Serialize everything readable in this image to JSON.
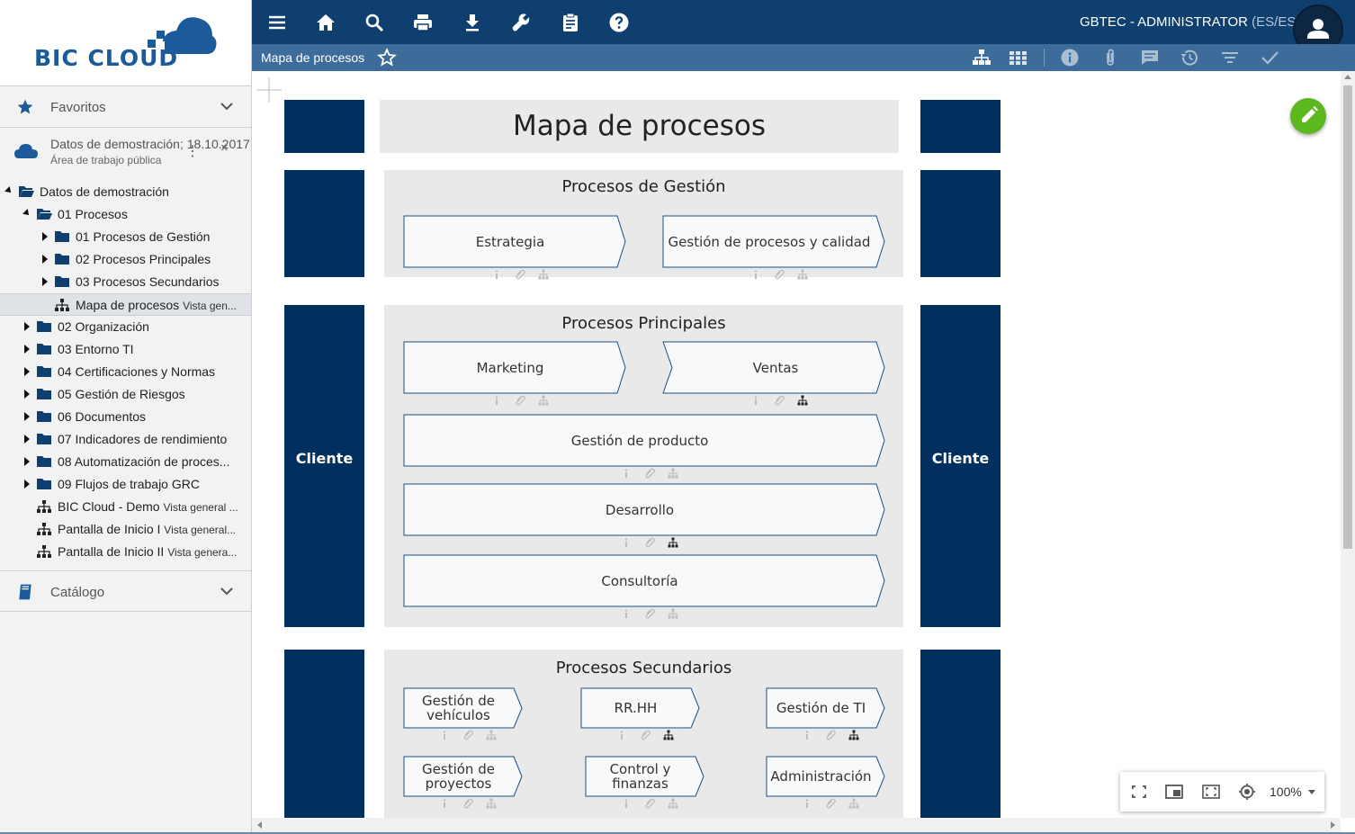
{
  "app": {
    "logo_text_bic": "BIC",
    "logo_text_cloud": "CLOUD"
  },
  "colors": {
    "topbar": "#0f3f6f",
    "subbar": "#3d6b9a",
    "navy_block": "#01305e",
    "grey_block": "#e9e9e9",
    "fab_green": "#5cb81e"
  },
  "sidebar": {
    "favorites": {
      "label": "Favoritos",
      "icon": "star-icon"
    },
    "workspace": {
      "name": "Datos de demostración; 18.10.2017",
      "subtitle": "Área de trabajo pública",
      "more": "⋮",
      "close": "×"
    },
    "tree": [
      {
        "label": "Datos de demostración",
        "sub": "",
        "icon": "folder-open-icon",
        "twisty": "open"
      },
      {
        "label": "01 Procesos",
        "sub": "",
        "icon": "folder-open-icon",
        "twisty": "open"
      },
      {
        "label": "01 Procesos de Gestión",
        "sub": "",
        "icon": "folder-icon",
        "twisty": "closed"
      },
      {
        "label": "02 Procesos Principales",
        "sub": "",
        "icon": "folder-icon",
        "twisty": "closed"
      },
      {
        "label": "03 Procesos Secundarios",
        "sub": "",
        "icon": "folder-icon",
        "twisty": "closed"
      },
      {
        "label": "Mapa de procesos",
        "sub": "Vista gen...",
        "icon": "hierarchy-icon",
        "twisty": "none",
        "selected": true
      },
      {
        "label": "02 Organización",
        "sub": "",
        "icon": "folder-icon",
        "twisty": "closed"
      },
      {
        "label": "03 Entorno TI",
        "sub": "",
        "icon": "folder-icon",
        "twisty": "closed"
      },
      {
        "label": "04 Certificaciones y Normas",
        "sub": "",
        "icon": "folder-icon",
        "twisty": "closed"
      },
      {
        "label": "05 Gestión de Riesgos",
        "sub": "",
        "icon": "folder-icon",
        "twisty": "closed"
      },
      {
        "label": "06 Documentos",
        "sub": "",
        "icon": "folder-icon",
        "twisty": "closed"
      },
      {
        "label": "07 Indicadores de rendimiento",
        "sub": "",
        "icon": "folder-icon",
        "twisty": "closed"
      },
      {
        "label": "08 Automatización de proces...",
        "sub": "",
        "icon": "folder-icon",
        "twisty": "closed"
      },
      {
        "label": "09 Flujos de trabajo GRC",
        "sub": "",
        "icon": "folder-icon",
        "twisty": "closed"
      },
      {
        "label": "BIC Cloud - Demo",
        "sub": "Vista general ...",
        "icon": "hierarchy-icon",
        "twisty": "none"
      },
      {
        "label": "Pantalla de Inicio I",
        "sub": "Vista general...",
        "icon": "hierarchy-icon",
        "twisty": "none"
      },
      {
        "label": "Pantalla de Inicio II",
        "sub": "Vista genera...",
        "icon": "hierarchy-icon",
        "twisty": "none"
      }
    ],
    "catalog": {
      "label": "Catálogo",
      "icon": "book-icon"
    }
  },
  "topbar": {
    "user": "GBTEC - ADMINISTRATOR",
    "lang": "(ES/ES)",
    "buttons": [
      "menu-icon",
      "home-icon",
      "search-icon",
      "print-icon",
      "download-icon",
      "wrench-icon",
      "clipboard-icon",
      "help-icon"
    ]
  },
  "subbar": {
    "title": "Mapa de procesos",
    "right_icons": [
      "hierarchy-view-icon",
      "grid-view-icon",
      "info-icon",
      "attachment-icon",
      "comments-icon",
      "history-icon",
      "filter-icon",
      "check-icon"
    ]
  },
  "map": {
    "title": "Mapa de procesos",
    "side_label_left": "Cliente",
    "side_label_right": "Cliente",
    "sections": [
      {
        "title": "Procesos de Gestión",
        "processes": [
          {
            "label": "Estrategia",
            "has_model": false
          },
          {
            "label": "Gestión de procesos y calidad",
            "has_model": false
          }
        ]
      },
      {
        "title": "Procesos Principales",
        "processes": [
          {
            "label": "Marketing",
            "has_model": false
          },
          {
            "label": "Ventas",
            "has_model": true
          },
          {
            "label": "Gestión de producto",
            "has_model": false
          },
          {
            "label": "Desarrollo",
            "has_model": true
          },
          {
            "label": "Consultoría",
            "has_model": false
          }
        ]
      },
      {
        "title": "Procesos Secundarios",
        "processes": [
          {
            "label": "Gestión de vehículos",
            "has_model": false
          },
          {
            "label": "RR.HH",
            "has_model": true
          },
          {
            "label": "Gestión de TI",
            "has_model": true
          },
          {
            "label": "Gestión de proyectos",
            "has_model": false
          },
          {
            "label": "Control y finanzas",
            "has_model": false
          },
          {
            "label": "Administración",
            "has_model": false
          }
        ]
      }
    ],
    "item_icons": [
      "info-small-icon",
      "clip-small-icon",
      "model-small-icon"
    ]
  },
  "zoom": {
    "value": "100%"
  }
}
